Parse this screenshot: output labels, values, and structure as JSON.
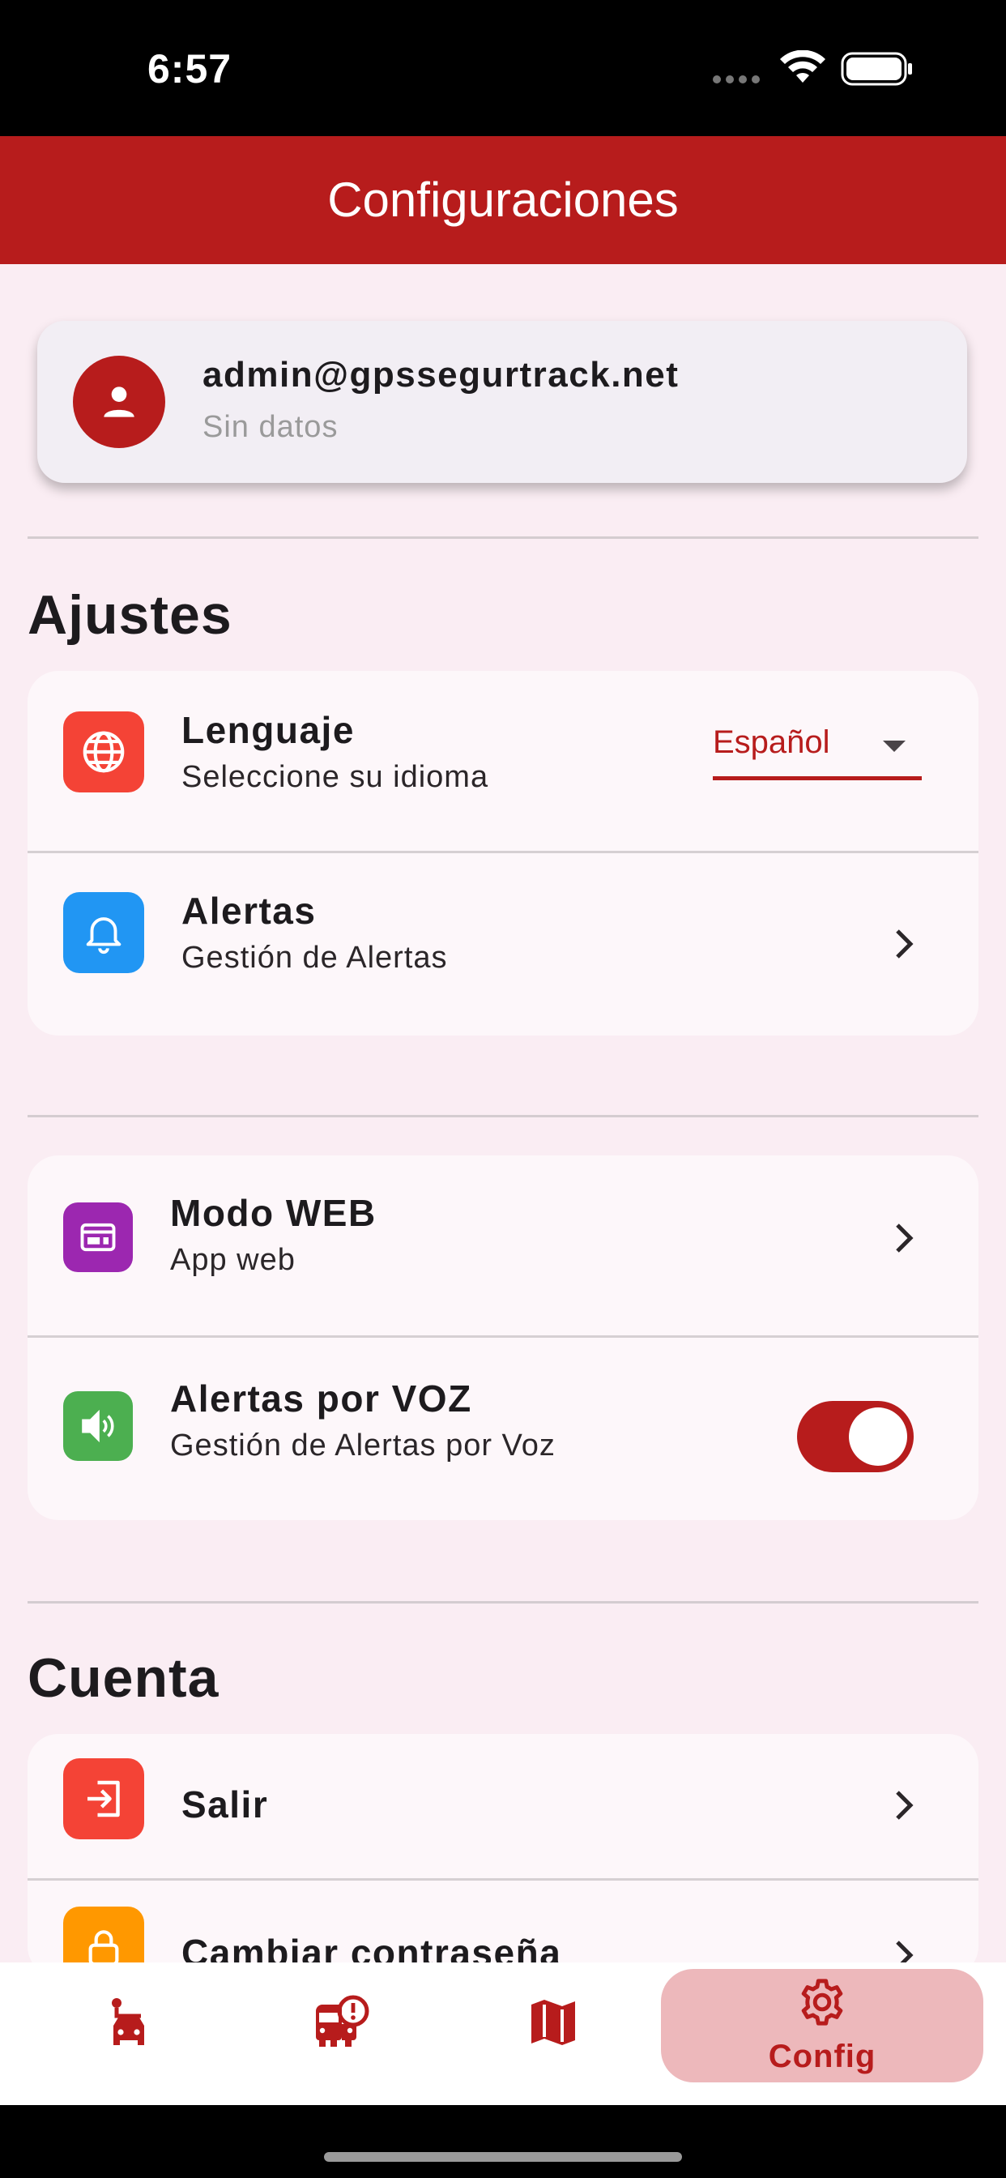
{
  "status_bar": {
    "time": "6:57"
  },
  "app_bar": {
    "title": "Configuraciones"
  },
  "profile": {
    "email": "admin@gpssegurtrack.net",
    "subtitle": "Sin datos"
  },
  "sections": {
    "ajustes_title": "Ajustes",
    "cuenta_title": "Cuenta"
  },
  "settings": {
    "language": {
      "title": "Lenguaje",
      "subtitle": "Seleccione su idioma",
      "selected": "Español",
      "icon": "globe-icon",
      "color": "#F44336"
    },
    "alerts": {
      "title": "Alertas",
      "subtitle": "Gestión de Alertas",
      "icon": "bell-icon",
      "color": "#2196F3"
    },
    "web_mode": {
      "title": "Modo WEB",
      "subtitle": "App web",
      "icon": "web-icon",
      "color": "#9C27B0"
    },
    "voice_alerts": {
      "title": "Alertas por VOZ",
      "subtitle": "Gestión de Alertas por Voz",
      "enabled": true,
      "icon": "speaker-icon",
      "color": "#4CAF50"
    }
  },
  "account": {
    "logout": {
      "title": "Salir",
      "icon": "logout-icon",
      "color": "#F44336"
    },
    "change_password": {
      "title": "Cambiar contraseña",
      "icon": "lock-icon",
      "color": "#FF9800"
    }
  },
  "bottom_nav": {
    "items": [
      {
        "icon": "car-icon"
      },
      {
        "icon": "bus-alert-icon"
      },
      {
        "icon": "map-icon"
      },
      {
        "icon": "gear-icon",
        "label": "Config",
        "active": true
      }
    ]
  },
  "colors": {
    "primary": "#B71C1C",
    "background": "#FAEDF3",
    "active_nav_bg": "#EDB8BB"
  }
}
